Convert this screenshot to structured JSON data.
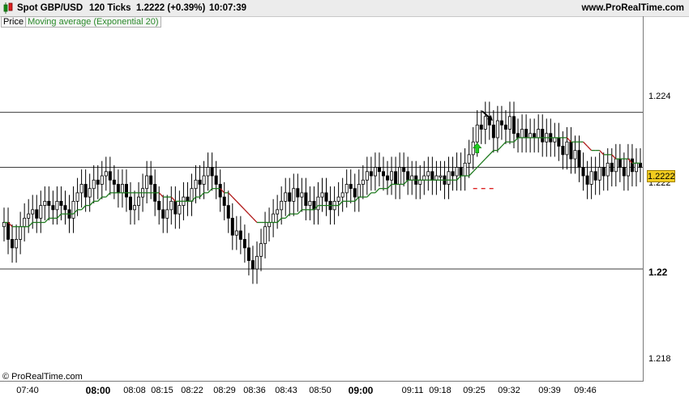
{
  "header": {
    "instrument": "Spot GBP/USD",
    "timeframe": "120 Ticks",
    "last_price_change": "1.2222 (+0.39%)",
    "time": "10:07:39",
    "site": "www.ProRealTime.com"
  },
  "legend": {
    "price_label": "Price",
    "indicator_label": "Moving average (Exponential 20)"
  },
  "watermark": "© ProRealTime.com",
  "price_badge": "1.2222",
  "colors": {
    "ema_up": "#1f7a1f",
    "ema_down": "#b01818",
    "candle_up": "#ffffff",
    "candle_down": "#000000",
    "level_line": "#3c3c3c",
    "badge": "#f2cc1f",
    "signal_arrow": "#22cc22",
    "stop_dash": "#dd2222"
  },
  "chart_data": {
    "type": "candlestick",
    "title": "Spot GBP/USD",
    "ylim": [
      1.2172,
      1.2255
    ],
    "y_ticks": [
      "1.224",
      "1.222",
      "1.22",
      "1.218"
    ],
    "x_ticks": [
      {
        "label": "07:40",
        "bold": false
      },
      {
        "label": "08:00",
        "bold": true
      },
      {
        "label": "08:08",
        "bold": false
      },
      {
        "label": "08:15",
        "bold": false
      },
      {
        "label": "08:22",
        "bold": false
      },
      {
        "label": "08:29",
        "bold": false
      },
      {
        "label": "08:36",
        "bold": false
      },
      {
        "label": "08:43",
        "bold": false
      },
      {
        "label": "08:50",
        "bold": false
      },
      {
        "label": "09:00",
        "bold": true
      },
      {
        "label": "09:11",
        "bold": false
      },
      {
        "label": "09:18",
        "bold": false
      },
      {
        "label": "09:25",
        "bold": false
      },
      {
        "label": "09:32",
        "bold": false
      },
      {
        "label": "09:39",
        "bold": false
      },
      {
        "label": "09:46",
        "bold": false
      }
    ],
    "horizontal_levels": [
      1.2235,
      1.2222,
      1.2198
    ],
    "close_series": [
      1.2209,
      1.2205,
      1.2203,
      1.2205,
      1.2208,
      1.221,
      1.2211,
      1.2212,
      1.221,
      1.2213,
      1.2214,
      1.2213,
      1.2212,
      1.2214,
      1.2213,
      1.2212,
      1.221,
      1.2214,
      1.2216,
      1.2218,
      1.2215,
      1.2217,
      1.2219,
      1.2218,
      1.222,
      1.2221,
      1.2219,
      1.2218,
      1.2216,
      1.2218,
      1.2215,
      1.2212,
      1.2213,
      1.2215,
      1.2217,
      1.222,
      1.2218,
      1.2214,
      1.2212,
      1.221,
      1.2212,
      1.2214,
      1.2211,
      1.2213,
      1.2215,
      1.2214,
      1.2217,
      1.2219,
      1.2218,
      1.222,
      1.2222,
      1.222,
      1.2218,
      1.2215,
      1.2213,
      1.221,
      1.2206,
      1.2207,
      1.2205,
      1.2203,
      1.22,
      1.2198,
      1.2201,
      1.2204,
      1.2208,
      1.2209,
      1.2211,
      1.2212,
      1.2214,
      1.2216,
      1.2214,
      1.2217,
      1.2215,
      1.2216,
      1.2213,
      1.2214,
      1.2212,
      1.2215,
      1.2216,
      1.2214,
      1.2212,
      1.2214,
      1.2215,
      1.2216,
      1.2218,
      1.2217,
      1.2215,
      1.2218,
      1.2219,
      1.2221,
      1.222,
      1.2222,
      1.2221,
      1.222,
      1.2219,
      1.2221,
      1.2218,
      1.2222,
      1.2221,
      1.2219,
      1.222,
      1.2218,
      1.2219,
      1.222,
      1.2221,
      1.2219,
      1.222,
      1.222,
      1.2218,
      1.2221,
      1.222,
      1.2222,
      1.222,
      1.2223,
      1.2225,
      1.2228,
      1.2232,
      1.2231,
      1.2234,
      1.2232,
      1.2229,
      1.2233,
      1.2232,
      1.2231,
      1.2234,
      1.223,
      1.2229,
      1.2231,
      1.2229,
      1.223,
      1.2229,
      1.2231,
      1.2228,
      1.223,
      1.2228,
      1.2229,
      1.2227,
      1.2225,
      1.2228,
      1.2224,
      1.2226,
      1.2222,
      1.222,
      1.2218,
      1.2221,
      1.2219,
      1.2222,
      1.222,
      1.2223,
      1.2221,
      1.2224,
      1.2222,
      1.222,
      1.2224,
      1.2221,
      1.2223,
      1.2222
    ],
    "ema_series": [
      1.2209,
      1.2209,
      1.2208,
      1.2208,
      1.2208,
      1.2208,
      1.2208,
      1.2209,
      1.2209,
      1.2209,
      1.2209,
      1.221,
      1.221,
      1.221,
      1.2211,
      1.2211,
      1.2211,
      1.2211,
      1.2212,
      1.2212,
      1.2213,
      1.2213,
      1.2214,
      1.2214,
      1.2215,
      1.2215,
      1.2216,
      1.2216,
      1.2216,
      1.2216,
      1.2216,
      1.2216,
      1.2216,
      1.2216,
      1.2216,
      1.2216,
      1.2216,
      1.2216,
      1.2216,
      1.2215,
      1.2215,
      1.2215,
      1.2214,
      1.2214,
      1.2214,
      1.2214,
      1.2214,
      1.2215,
      1.2215,
      1.2216,
      1.2216,
      1.2217,
      1.2217,
      1.2217,
      1.2216,
      1.2216,
      1.2215,
      1.2214,
      1.2213,
      1.2212,
      1.2211,
      1.221,
      1.2209,
      1.2209,
      1.2209,
      1.2209,
      1.2209,
      1.2209,
      1.221,
      1.221,
      1.2211,
      1.2211,
      1.2211,
      1.2212,
      1.2212,
      1.2212,
      1.2212,
      1.2213,
      1.2213,
      1.2213,
      1.2213,
      1.2213,
      1.2213,
      1.2214,
      1.2214,
      1.2214,
      1.2214,
      1.2215,
      1.2215,
      1.2215,
      1.2216,
      1.2216,
      1.2217,
      1.2217,
      1.2217,
      1.2218,
      1.2218,
      1.2218,
      1.2218,
      1.2219,
      1.2219,
      1.2219,
      1.2219,
      1.2219,
      1.2219,
      1.2219,
      1.2219,
      1.2219,
      1.2219,
      1.2219,
      1.2219,
      1.2219,
      1.222,
      1.222,
      1.222,
      1.2221,
      1.2222,
      1.2223,
      1.2224,
      1.2225,
      1.2226,
      1.2226,
      1.2227,
      1.2228,
      1.2228,
      1.2228,
      1.2229,
      1.2229,
      1.2229,
      1.2229,
      1.2229,
      1.2229,
      1.2229,
      1.2229,
      1.2229,
      1.2229,
      1.2229,
      1.2229,
      1.2229,
      1.2228,
      1.2228,
      1.2228,
      1.2228,
      1.2227,
      1.2226,
      1.2226,
      1.2226,
      1.2225,
      1.2225,
      1.2225,
      1.2224,
      1.2224,
      1.2224,
      1.2224,
      1.2223,
      1.2223,
      1.2223
    ],
    "buy_signal_index": 116,
    "sell_signal_index": 120,
    "stop_level": 1.2217
  }
}
